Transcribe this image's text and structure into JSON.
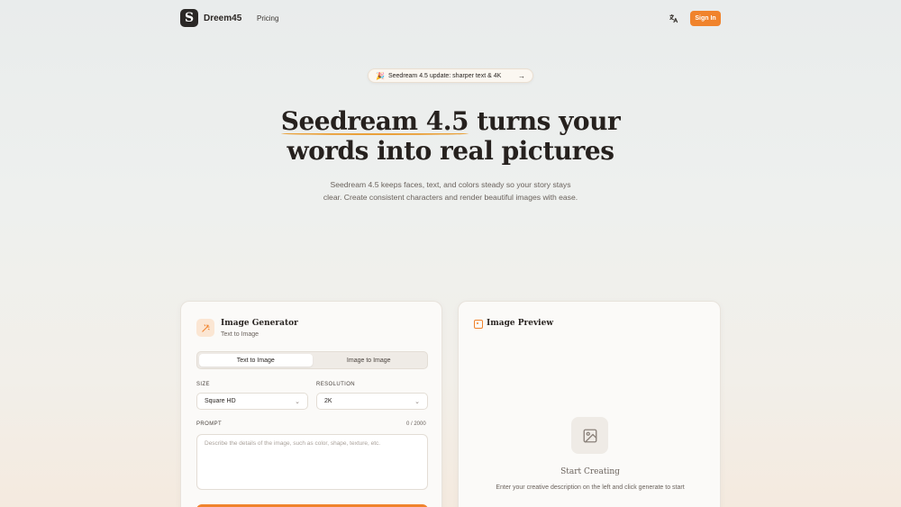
{
  "header": {
    "brand": "Dreem45",
    "logo_letter": "S",
    "nav": {
      "pricing": "Pricing"
    },
    "lang_icon": "translate-icon",
    "sign_in": "Sign In"
  },
  "announcement": {
    "text": "Seedream 4.5 update: sharper text & 4K",
    "icon": "party-popper-icon",
    "arrow": "→"
  },
  "hero": {
    "title_highlight": "Seedream 4.5",
    "title_rest_line1": " turns your",
    "title_line2": "words into real pictures",
    "subtitle_line1": "Seedream 4.5 keeps faces, text, and colors steady so your story stays",
    "subtitle_line2": "clear. Create consistent characters and render beautiful images with ease."
  },
  "generator": {
    "title": "Image Generator",
    "subtitle": "Text to Image",
    "tabs": [
      {
        "label": "Text to Image",
        "active": true
      },
      {
        "label": "Image to Image",
        "active": false
      }
    ],
    "size_label": "SIZE",
    "size_value": "Square HD",
    "resolution_label": "RESOLUTION",
    "resolution_value": "2K",
    "prompt_label": "PROMPT",
    "prompt_count": "0 / 2000",
    "prompt_placeholder": "Describe the details of the image, such as color, shape, texture, etc."
  },
  "preview": {
    "title": "Image Preview",
    "empty_title": "Start Creating",
    "empty_desc": "Enter your creative description on the left and click generate to start"
  },
  "colors": {
    "accent": "#f0832c",
    "underline": "#e9a13b",
    "text": "#2a2522",
    "muted": "#6a625c"
  }
}
